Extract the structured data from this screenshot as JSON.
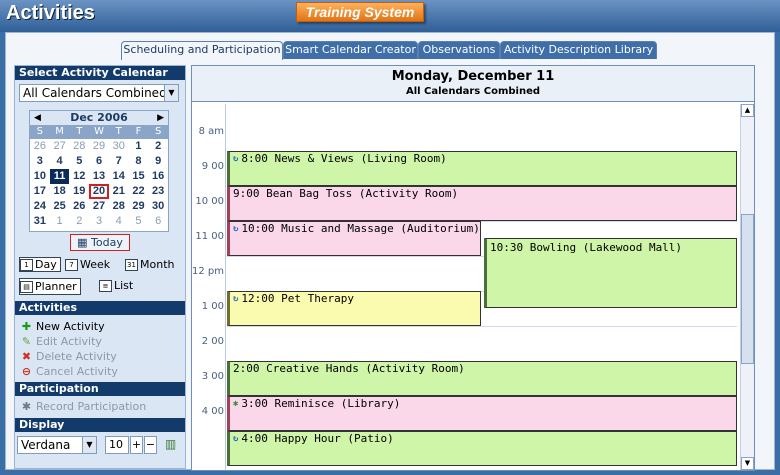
{
  "app": {
    "title": "Activities",
    "brand": "Training System"
  },
  "tabs": [
    {
      "label": "Scheduling and Participation"
    },
    {
      "label": "Smart Calendar Creator"
    },
    {
      "label": "Observations"
    },
    {
      "label": "Activity Description Library"
    }
  ],
  "left": {
    "select_calendar_header": "Select Activity Calendar",
    "calendar_select_value": "All Calendars Combined",
    "minical": {
      "month_label": "Dec 2006",
      "dows": [
        "S",
        "M",
        "T",
        "W",
        "T",
        "F",
        "S"
      ],
      "weeks": [
        [
          "26",
          "27",
          "28",
          "29",
          "30",
          "1",
          "2"
        ],
        [
          "3",
          "4",
          "5",
          "6",
          "7",
          "8",
          "9"
        ],
        [
          "10",
          "11",
          "12",
          "13",
          "14",
          "15",
          "16"
        ],
        [
          "17",
          "18",
          "19",
          "20",
          "21",
          "22",
          "23"
        ],
        [
          "24",
          "25",
          "26",
          "27",
          "28",
          "29",
          "30"
        ],
        [
          "31",
          "1",
          "2",
          "3",
          "4",
          "5",
          "6"
        ]
      ]
    },
    "today_label": "Today",
    "views": {
      "day": "Day",
      "week": "Week",
      "month": "Month",
      "planner": "Planner",
      "list": "List"
    },
    "activities_header": "Activities",
    "actions": {
      "new": "New Activity",
      "edit": "Edit Activity",
      "delete": "Delete Activity",
      "cancel": "Cancel Activity"
    },
    "participation_header": "Participation",
    "record_participation": "Record Participation",
    "display_header": "Display",
    "font_value": "Verdana",
    "font_size": "10"
  },
  "calendar": {
    "date_title": "Monday, December 11",
    "subtitle": "All Calendars Combined",
    "times": [
      "8 am",
      "9 00",
      "10 00",
      "11 00",
      "12 pm",
      "1 00",
      "2 00",
      "3 00",
      "4 00"
    ],
    "events": [
      {
        "text": "8:00 News & Views (Living Room)"
      },
      {
        "text": "9:00 Bean Bag Toss (Activity Room)"
      },
      {
        "text": "10:00 Music and Massage (Auditorium)"
      },
      {
        "text": "10:30 Bowling (Lakewood Mall)"
      },
      {
        "text": "12:00 Pet Therapy"
      },
      {
        "text": "2:00 Creative Hands (Activity Room)"
      },
      {
        "text": "3:00 Reminisce (Library)"
      },
      {
        "text": "4:00 Happy Hour (Patio)"
      }
    ]
  }
}
